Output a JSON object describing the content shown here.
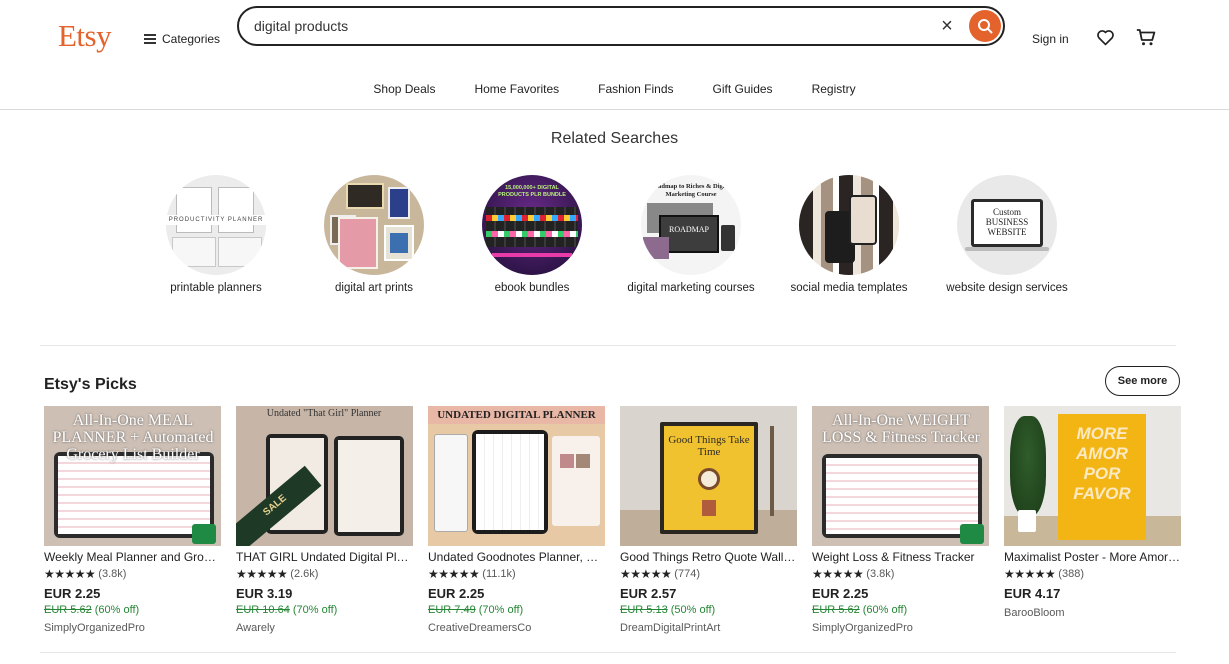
{
  "header": {
    "logo": "Etsy",
    "categories_label": "Categories",
    "search_value": "digital products",
    "sign_in": "Sign in",
    "accent": "#e4622c"
  },
  "nav": [
    "Shop Deals",
    "Home Favorites",
    "Fashion Finds",
    "Gift Guides",
    "Registry"
  ],
  "related": {
    "title": "Related Searches",
    "items": [
      {
        "label": "printable planners",
        "thumb_text": "PRODUCTIVITY PLANNER"
      },
      {
        "label": "digital art prints",
        "thumb_text": ""
      },
      {
        "label": "ebook bundles",
        "thumb_text": "15,000,000+ DIGITAL PRODUCTS PLR BUNDLE"
      },
      {
        "label": "digital marketing courses",
        "thumb_text": "Roadmap to Riches & Digital Marketing Course"
      },
      {
        "label": "social media templates",
        "thumb_text": ""
      },
      {
        "label": "website design services",
        "thumb_text": "Custom BUSINESS WEBSITE"
      }
    ]
  },
  "picks": {
    "title": "Etsy's Picks",
    "see_more": "See more",
    "items": [
      {
        "title": "Weekly Meal Planner and Grocery List Builder",
        "reviews": "(3.8k)",
        "price": "EUR 2.25",
        "original": "EUR 5.62",
        "discount": "(60% off)",
        "shop": "SimplyOrganizedPro",
        "thumb_text": "All-In-One MEAL PLANNER + Automated Grocery List Builder"
      },
      {
        "title": "THAT GIRL Undated Digital Planner",
        "reviews": "(2.6k)",
        "price": "EUR 3.19",
        "original": "EUR 10.64",
        "discount": "(70% off)",
        "shop": "Awarely",
        "thumb_text": "Undated \"That Girl\" Planner"
      },
      {
        "title": "Undated Goodnotes Planner, Digital Planner",
        "reviews": "(11.1k)",
        "price": "EUR 2.25",
        "original": "EUR 7.49",
        "discount": "(70% off)",
        "shop": "CreativeDreamersCo",
        "thumb_text": "UNDATED DIGITAL PLANNER"
      },
      {
        "title": "Good Things Retro Quote Wall Art",
        "reviews": "(774)",
        "price": "EUR 2.57",
        "original": "EUR 5.13",
        "discount": "(50% off)",
        "shop": "DreamDigitalPrintArt",
        "thumb_text": "Good Things Take Time"
      },
      {
        "title": "Weight Loss & Fitness Tracker",
        "reviews": "(3.8k)",
        "price": "EUR 2.25",
        "original": "EUR 5.62",
        "discount": "(60% off)",
        "shop": "SimplyOrganizedPro",
        "thumb_text": "All-In-One WEIGHT LOSS & Fitness Tracker"
      },
      {
        "title": "Maximalist Poster - More Amor Por Favor",
        "reviews": "(388)",
        "price": "EUR 4.17",
        "original": "",
        "discount": "",
        "shop": "BarooBloom",
        "thumb_text": "MORE AMOR POR FAVOR"
      }
    ]
  }
}
